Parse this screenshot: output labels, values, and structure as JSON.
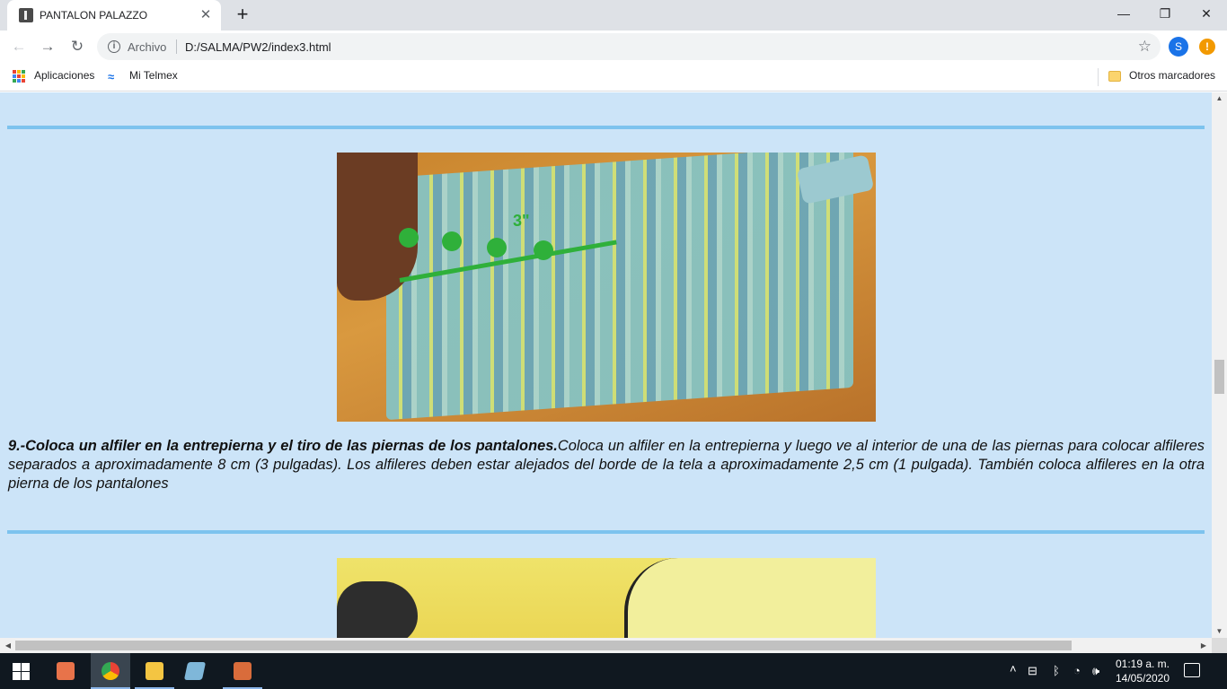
{
  "browser": {
    "tab_title": "PANTALON PALAZZO",
    "close_glyph": "✕",
    "new_tab_glyph": "+",
    "window_controls": {
      "minimize": "—",
      "restore": "❐",
      "close": "✕"
    },
    "nav": {
      "back": "←",
      "forward": "→",
      "reload": "↻"
    },
    "address": {
      "info_glyph": "i",
      "scheme_label": "Archivo",
      "url": "D:/SALMA/PW2/index3.html",
      "star_glyph": "☆"
    },
    "profile_initial": "S",
    "alert_glyph": "!",
    "bookmarks": {
      "apps": "Aplicaciones",
      "telmex": "Mi Telmex",
      "telmex_glyph": "≈",
      "others": "Otros marcadores"
    }
  },
  "page": {
    "photo1_overlay_text": "3\"",
    "step9": {
      "title": "9.-Coloca un alfiler en la entrepierna y el tiro de las piernas de los pantalones.",
      "body": "Coloca un alfiler en la entrepierna y luego ve al interior de una de las piernas para colocar alfileres separados a aproximadamente 8 cm (3 pulgadas). Los alfileres deben estar alejados del borde de la tela a aproximadamente 2,5 cm (1 pulgada). También coloca alfileres en la otra pierna de los pantalones"
    }
  },
  "scroll": {
    "up": "▲",
    "down": "▼",
    "left": "◀",
    "right": "▶"
  },
  "taskbar": {
    "tray": {
      "chevron": "˄",
      "network_glyph": "⊟",
      "bluetooth_glyph": "ᛒ",
      "wifi_glyph": "◔",
      "volume_glyph": "🕪"
    },
    "time": "01:19 a. m.",
    "date": "14/05/2020"
  },
  "colors": {
    "page_bg": "#cce4f8",
    "rule": "#7dc3ee",
    "accent_green": "#2fb03a"
  }
}
